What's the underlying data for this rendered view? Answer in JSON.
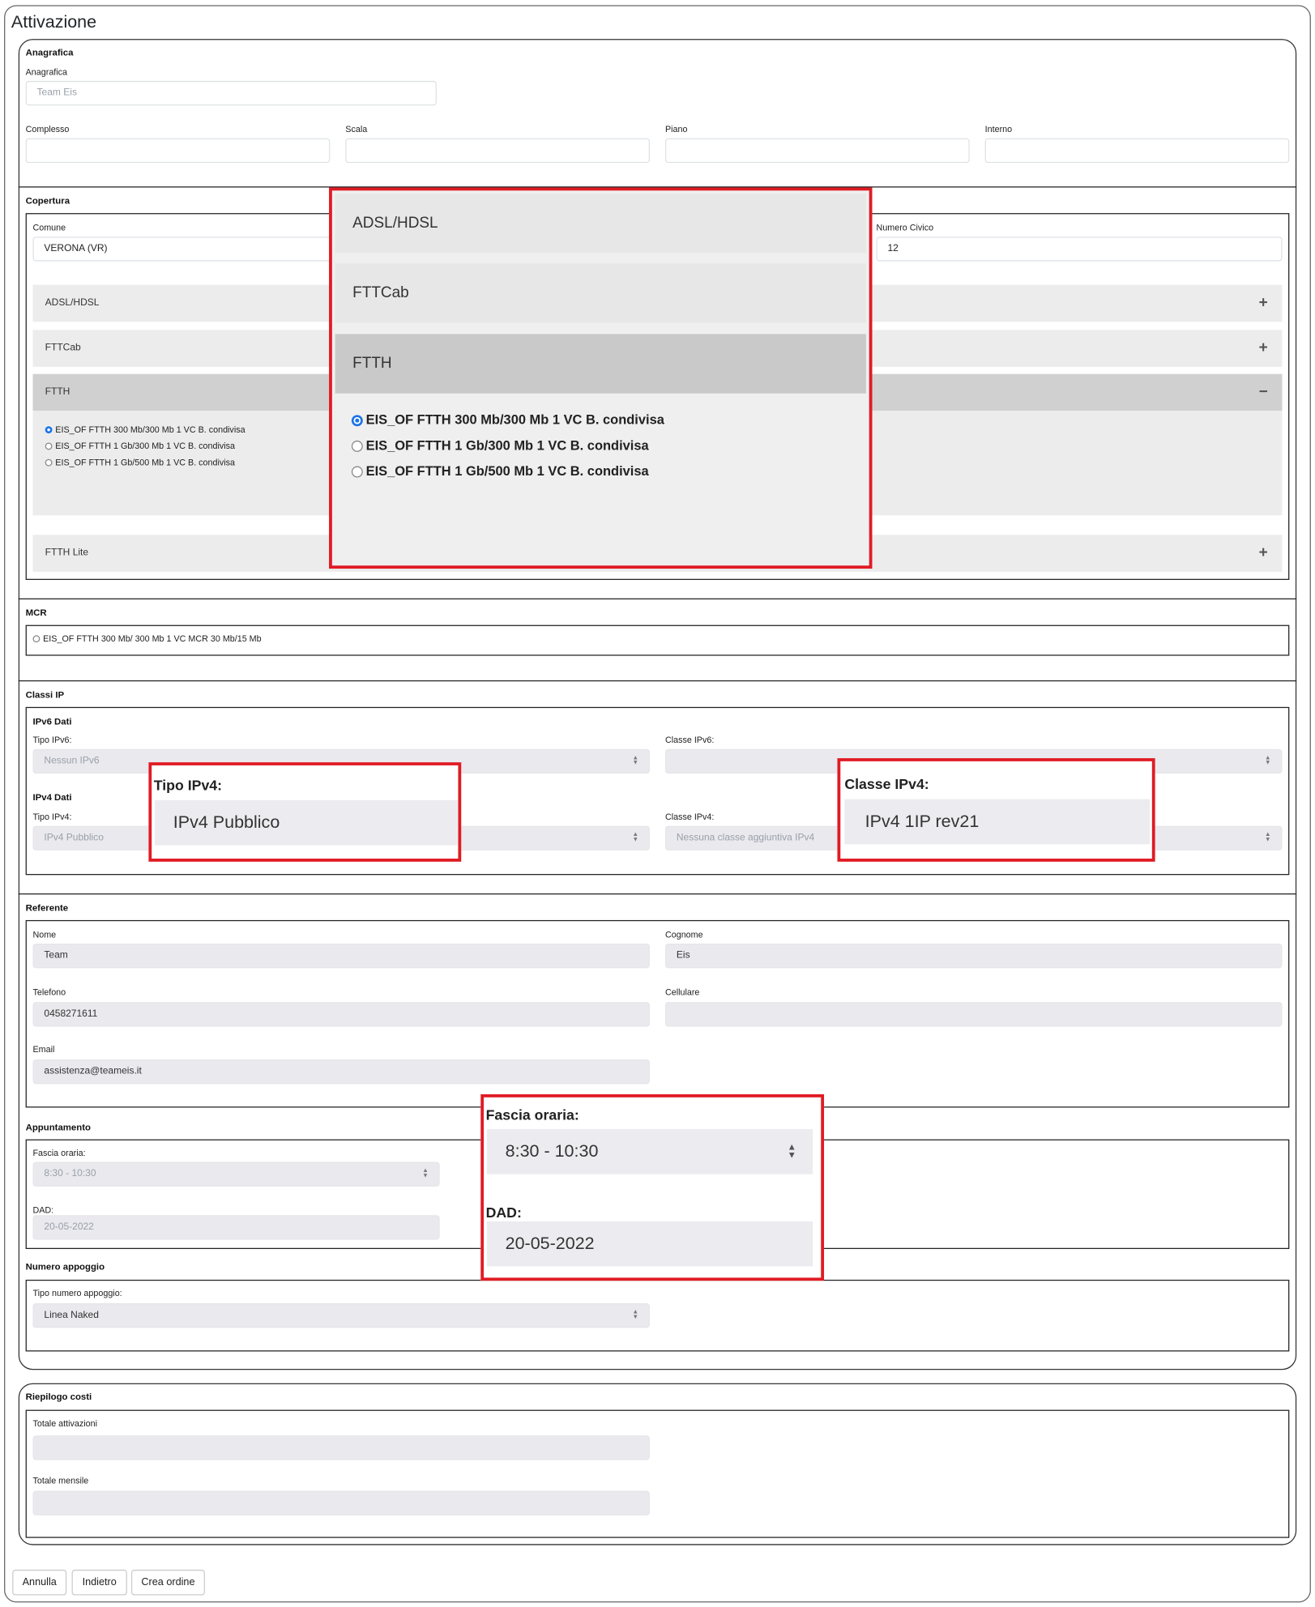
{
  "page": {
    "title": "Attivazione"
  },
  "anagrafica": {
    "section": "Anagrafica",
    "field_label": "Anagrafica",
    "field_value": "Team Eis",
    "complesso_label": "Complesso",
    "scala_label": "Scala",
    "piano_label": "Piano",
    "interno_label": "Interno"
  },
  "copertura": {
    "section": "Copertura",
    "comune_label": "Comune",
    "comune_value": "VERONA (VR)",
    "civico_label": "Numero Civico",
    "civico_value": "12",
    "accordions": [
      {
        "label": "ADSL/HDSL",
        "state": "+"
      },
      {
        "label": "FTTCab",
        "state": "+"
      },
      {
        "label": "FTTH",
        "state": "−"
      },
      {
        "label": "FTTH Lite",
        "state": "+"
      }
    ],
    "ftth_options": [
      {
        "label": "EIS_OF FTTH 300 Mb/300 Mb 1 VC B. condivisa",
        "selected": true
      },
      {
        "label": "EIS_OF FTTH 1 Gb/300 Mb 1 VC B. condivisa",
        "selected": false
      },
      {
        "label": "EIS_OF FTTH 1 Gb/500 Mb 1 VC B. condivisa",
        "selected": false
      }
    ]
  },
  "mcr": {
    "section": "MCR",
    "option": "EIS_OF FTTH 300 Mb/ 300 Mb 1 VC MCR 30 Mb/15 Mb"
  },
  "classi_ip": {
    "section": "Classi IP",
    "ipv6_title": "IPv6 Dati",
    "tipo_ipv6_label": "Tipo IPv6:",
    "tipo_ipv6_value": "Nessun IPv6",
    "classe_ipv6_label": "Classe IPv6:",
    "ipv4_title": "IPv4 Dati",
    "tipo_ipv4_label": "Tipo IPv4:",
    "tipo_ipv4_value": "IPv4 Pubblico",
    "classe_ipv4_label": "Classe IPv4:",
    "classe_ipv4_value": "Nessuna classe aggiuntiva IPv4"
  },
  "referente": {
    "section": "Referente",
    "nome_label": "Nome",
    "nome_value": "Team",
    "cognome_label": "Cognome",
    "cognome_value": "Eis",
    "telefono_label": "Telefono",
    "telefono_value": "0458271611",
    "cellulare_label": "Cellulare",
    "email_label": "Email",
    "email_value": "assistenza@teameis.it"
  },
  "appuntamento": {
    "section": "Appuntamento",
    "fascia_label": "Fascia oraria:",
    "fascia_value": "8:30 - 10:30",
    "dad_label": "DAD:",
    "dad_value": "20-05-2022"
  },
  "numero_appoggio": {
    "section": "Numero appoggio",
    "tipo_label": "Tipo numero appoggio:",
    "tipo_value": "Linea Naked"
  },
  "riepilogo": {
    "section": "Riepilogo costi",
    "totale_attivazioni_label": "Totale attivazioni",
    "totale_mensile_label": "Totale mensile"
  },
  "buttons": {
    "annulla": "Annulla",
    "indietro": "Indietro",
    "crea_ordine": "Crea ordine"
  },
  "callouts": {
    "access": {
      "items": [
        "ADSL/HDSL",
        "FTTCab",
        "FTTH"
      ],
      "options": [
        {
          "label": "EIS_OF FTTH 300 Mb/300 Mb 1 VC B. condivisa",
          "selected": true
        },
        {
          "label": "EIS_OF FTTH 1 Gb/300 Mb 1 VC B. condivisa",
          "selected": false
        },
        {
          "label": "EIS_OF FTTH 1 Gb/500 Mb 1 VC B. condivisa",
          "selected": false
        }
      ]
    },
    "tipo_ipv4": {
      "label": "Tipo IPv4:",
      "value": "IPv4 Pubblico"
    },
    "classe_ipv4": {
      "label": "Classe IPv4:",
      "value": "IPv4 1IP rev21"
    },
    "appuntamento": {
      "fascia_label": "Fascia oraria:",
      "fascia_value": "8:30 - 10:30",
      "dad_label": "DAD:",
      "dad_value": "20-05-2022"
    }
  },
  "colors": {
    "highlight": "#e01b24",
    "radio_selected": "#1a73e8",
    "input_disabled": "#e9e9ee",
    "accordion": "#ececec",
    "accordion_active": "#d0d0d0"
  }
}
